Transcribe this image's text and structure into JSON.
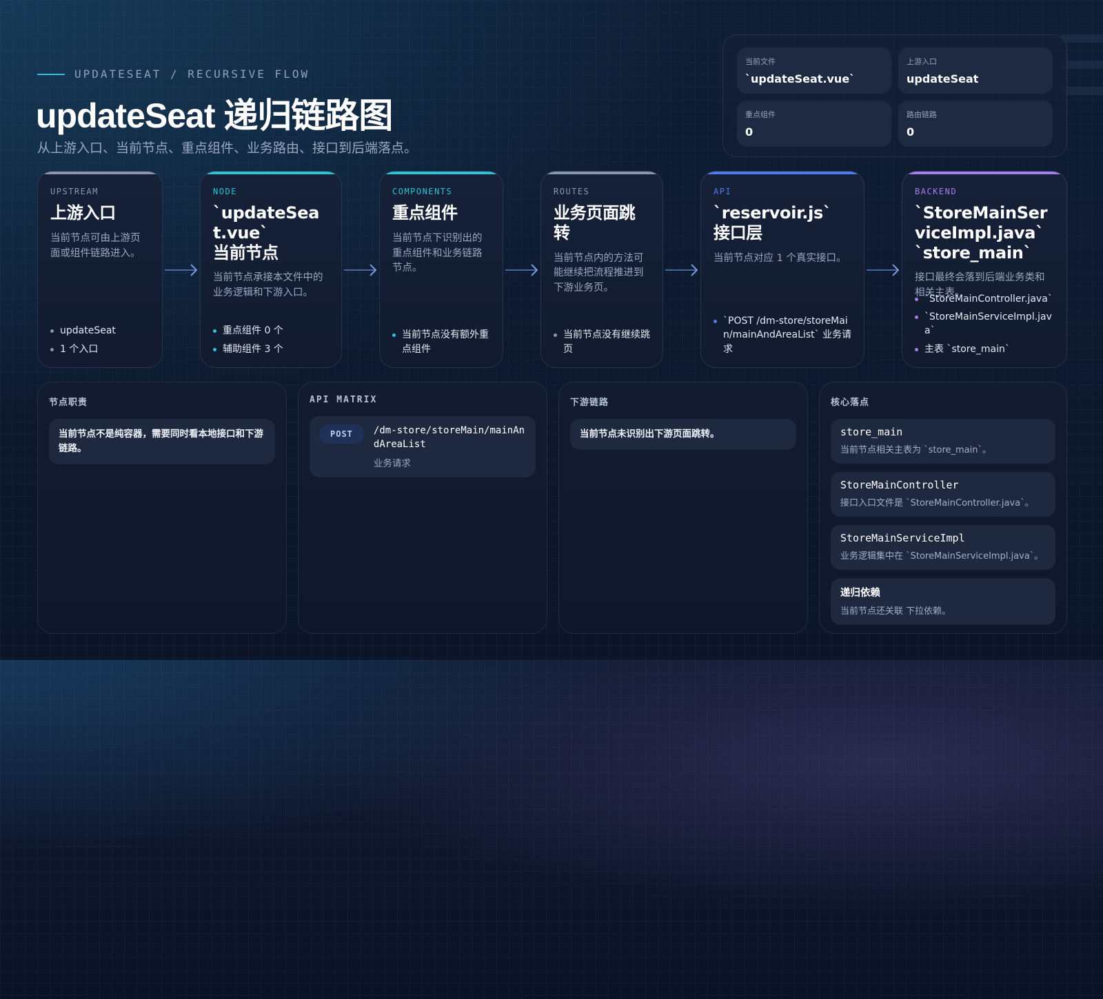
{
  "header": {
    "eyebrow": "UPDATESEAT / RECURSIVE FLOW",
    "title": "updateSeat 递归链路图",
    "subtitle": "从上游入口、当前节点、重点组件、业务路由、接口到后端落点。"
  },
  "stats": [
    {
      "label": "当前文件",
      "value": "`updateSeat.vue`"
    },
    {
      "label": "上游入口",
      "value": "updateSeat"
    },
    {
      "label": "重点组件",
      "value": "0"
    },
    {
      "label": "路由链路",
      "value": "0"
    }
  ],
  "flow": [
    {
      "tag": "UPSTREAM",
      "color": "#8a97ad",
      "heading": "上游入口",
      "desc": "当前节点可由上游页面或组件链路进入。",
      "items": [
        "updateSeat",
        "1 个入口"
      ]
    },
    {
      "tag": "NODE",
      "color": "#2ec4d6",
      "heading": "`updateSeat.vue`\n当前节点",
      "desc": "当前节点承接本文件中的业务逻辑和下游入口。",
      "items": [
        "重点组件 0 个",
        "辅助组件 3 个"
      ]
    },
    {
      "tag": "COMPONENTS",
      "color": "#2ec4d6",
      "heading": "重点组件",
      "desc": "当前节点下识别出的重点组件和业务链路节点。",
      "items": [
        "当前节点没有额外重点组件"
      ]
    },
    {
      "tag": "ROUTES",
      "color": "#8a97ad",
      "heading": "业务页面跳转",
      "desc": "当前节点内的方法可能继续把流程推进到下游业务页。",
      "items": [
        "当前节点没有继续跳页"
      ]
    },
    {
      "tag": "API",
      "color": "#4f7df0",
      "heading": "`reservoir.js`\n接口层",
      "desc": "当前节点对应 1 个真实接口。",
      "items": [
        "`POST /dm-store/storeMain/mainAndAreaList` 业务请求"
      ]
    },
    {
      "tag": "BACKEND",
      "color": "#a37ff0",
      "heading": "`StoreMainServiceImpl.java`\n`store_main`",
      "desc": "接口最终会落到后端业务类和相关主表。",
      "items": [
        "`StoreMainController.java`",
        "`StoreMainServiceImpl.java`",
        "主表 `store_main`"
      ]
    }
  ],
  "panels": {
    "duty": {
      "title": "节点职责",
      "note": "当前节点不是纯容器，需要同时看本地接口和下游链路。"
    },
    "api": {
      "title": "API MATRIX",
      "method": "POST",
      "path": "/dm-store/storeMain/mainAndAreaList",
      "desc": "业务请求"
    },
    "downstream": {
      "title": "下游链路",
      "note": "当前节点未识别出下游页面跳转。"
    },
    "core": {
      "title": "核心落点",
      "items": [
        {
          "name": "store_main",
          "desc": "当前节点相关主表为 `store_main`。"
        },
        {
          "name": "StoreMainController",
          "desc": "接口入口文件是 `StoreMainController.java`。"
        },
        {
          "name": "StoreMainServiceImpl",
          "desc": "业务逻辑集中在 `StoreMainServiceImpl.java`。"
        },
        {
          "name": "递归依赖",
          "desc": "当前节点还关联 下拉依赖。"
        }
      ]
    }
  }
}
